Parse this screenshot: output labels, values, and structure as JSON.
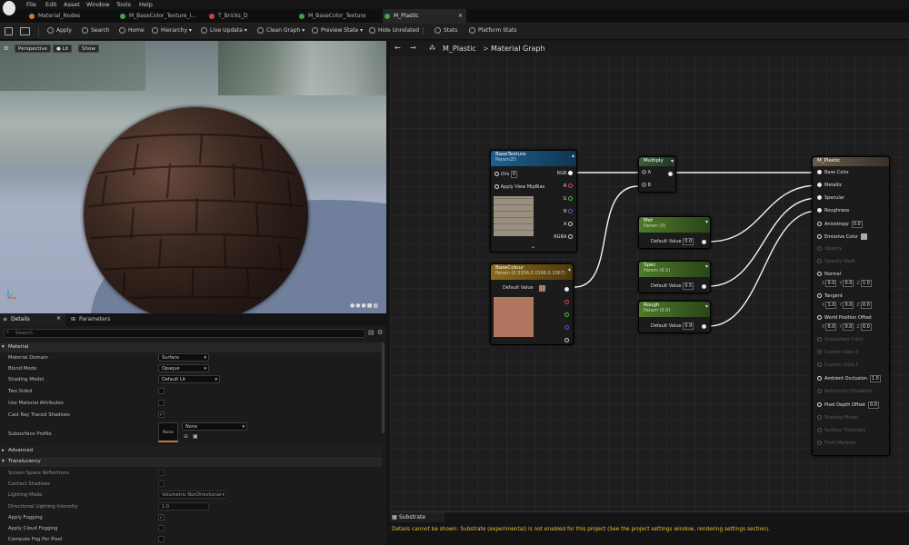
{
  "menu": [
    "File",
    "Edit",
    "Asset",
    "Window",
    "Tools",
    "Help"
  ],
  "tabs": [
    {
      "label": "Material_Nodes",
      "color": "#c77a3a",
      "active": false
    },
    {
      "label": "M_BaseColor_Texture_I...",
      "color": "#3fa34d",
      "active": false
    },
    {
      "label": "T_Bricks_D",
      "color": "#c24444",
      "active": false
    },
    {
      "label": "M_BaseColor_Texture",
      "color": "#3fa34d",
      "active": false
    },
    {
      "label": "M_Plastic",
      "color": "#3fa34d",
      "active": true
    }
  ],
  "toolbar": {
    "apply": "Apply",
    "search": "Search",
    "home": "Home",
    "hierarchy": "Hierarchy",
    "live_update": "Live Update",
    "clean_graph": "Clean Graph",
    "preview_state": "Preview State",
    "hide_unrelated": "Hide Unrelated",
    "stats": "Stats",
    "platform_stats": "Platform Stats"
  },
  "viewport": {
    "perspective": "Perspective",
    "lit": "Lit",
    "show": "Show"
  },
  "details": {
    "tab_details": "Details",
    "tab_parameters": "Parameters",
    "search_placeholder": "Search",
    "section_material": "Material",
    "material_domain_label": "Material Domain",
    "material_domain": "Surface",
    "blend_mode_label": "Blend Mode",
    "blend_mode": "Opaque",
    "shading_model_label": "Shading Model",
    "shading_model": "Default Lit",
    "two_sided_label": "Two Sided",
    "use_material_attributes_label": "Use Material Attributes",
    "cast_ray_traced_shadows_label": "Cast Ray Traced Shadows",
    "subsurface_profile_label": "Subsurface Profile",
    "subsurface_profile": "None",
    "subsurface_thumb": "None",
    "section_advanced": "Advanced",
    "section_translucency": "Translucency",
    "screen_space_reflections_label": "Screen Space Reflections",
    "contact_shadows_label": "Contact Shadows",
    "lighting_mode_label": "Lighting Mode",
    "lighting_mode": "Volumetric NonDirectional",
    "directional_lighting_intensity_label": "Directional Lighting Intensity",
    "directional_lighting_intensity": "1.0",
    "apply_fogging_label": "Apply Fogging",
    "apply_cloud_fogging_label": "Apply Cloud Fogging",
    "compute_fog_per_pixel_label": "Compute Fog Per Pixel"
  },
  "graph": {
    "breadcrumb_asset": "M_Plastic",
    "breadcrumb_sep": ">",
    "breadcrumb_view": "Material Graph",
    "nodes": {
      "basetexture": {
        "title": "BaseTexture",
        "subtitle": "Param2D",
        "uvs": "UVs",
        "uvs_value": "0",
        "apply_mipbias": "Apply View MipBias",
        "outputs": [
          "RGB",
          "R",
          "G",
          "B",
          "A",
          "RGBA"
        ]
      },
      "multiply": {
        "title": "Multiply",
        "a": "A",
        "b": "B"
      },
      "basecolour": {
        "title": "BaseColour",
        "subtitle": "Param (0.3356,0.1568,0.1067)",
        "default_value": "Default Value",
        "swatch": "#b07660"
      },
      "met": {
        "title": "Met",
        "subtitle": "Param (0)",
        "default_value": "Default Value",
        "value": "0.0"
      },
      "spec": {
        "title": "Spec",
        "subtitle": "Param (0.5)",
        "default_value": "Default Value",
        "value": "0.5"
      },
      "rough": {
        "title": "Rough",
        "subtitle": "Param (0.9)",
        "default_value": "Default Value",
        "value": "0.9"
      },
      "result": {
        "title": "M_Plastic",
        "inputs": [
          {
            "label": "Base Color",
            "enabled": true
          },
          {
            "label": "Metallic",
            "enabled": true
          },
          {
            "label": "Specular",
            "enabled": true
          },
          {
            "label": "Roughness",
            "enabled": true
          },
          {
            "label": "Anisotropy",
            "enabled": true,
            "value": "0.0"
          },
          {
            "label": "Emissive Color",
            "enabled": true
          },
          {
            "label": "Opacity",
            "enabled": false
          },
          {
            "label": "Opacity Mask",
            "enabled": false
          },
          {
            "label": "Normal",
            "enabled": true
          },
          {
            "label": "Tangent",
            "enabled": true
          },
          {
            "label": "World Position Offset",
            "enabled": true
          },
          {
            "label": "Subsurface Color",
            "enabled": false
          },
          {
            "label": "Custom Data 0",
            "enabled": false
          },
          {
            "label": "Custom Data 1",
            "enabled": false
          },
          {
            "label": "Ambient Occlusion",
            "enabled": true,
            "value": "1.0"
          },
          {
            "label": "Refraction (Disabled)",
            "enabled": false
          },
          {
            "label": "Pixel Depth Offset",
            "enabled": true,
            "value": "0.0"
          },
          {
            "label": "Shading Model",
            "enabled": false
          },
          {
            "label": "Surface Thickness",
            "enabled": false
          },
          {
            "label": "Front Material",
            "enabled": false
          }
        ],
        "normal_xyz": [
          "0.0",
          "0.0",
          "1.0"
        ],
        "tangent_xyz": [
          "1.0",
          "0.0",
          "0.0"
        ],
        "wpo_xyz": [
          "0.0",
          "0.0",
          "0.0"
        ]
      }
    }
  },
  "substrate": {
    "tab": "Substrate",
    "message": "Details cannot be shown: Substrate (experimental) is not enabled for this project (See the project settings window, rendering settings section)."
  }
}
